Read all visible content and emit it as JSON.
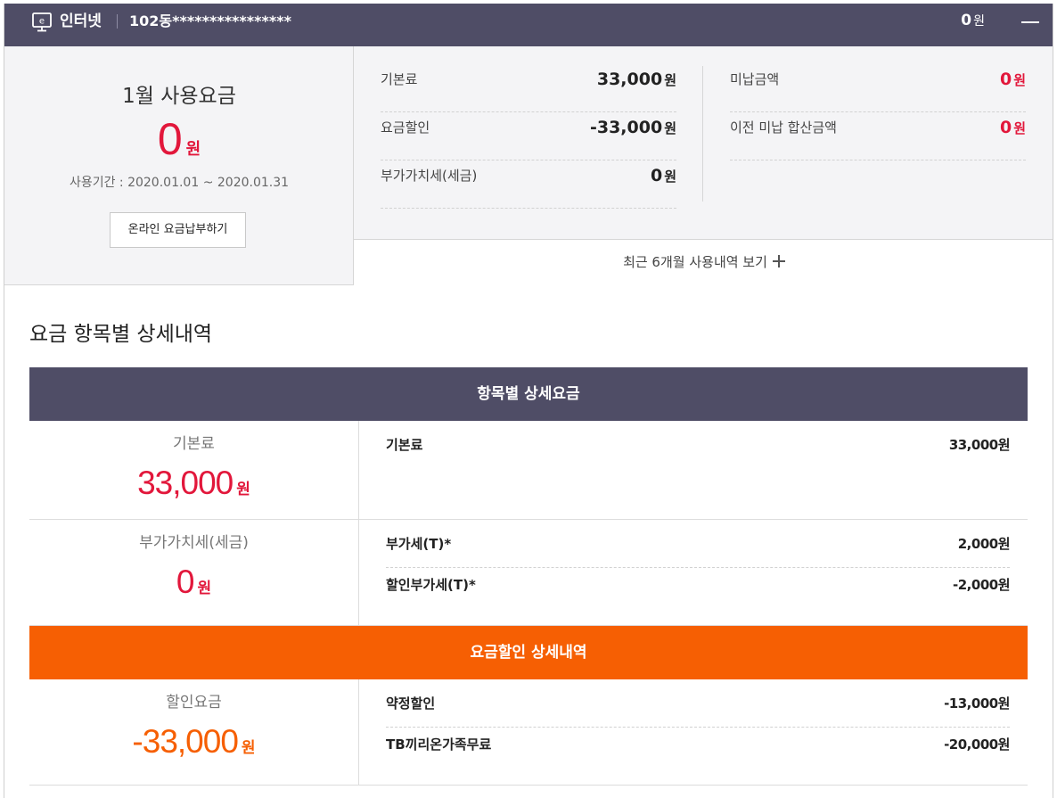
{
  "header": {
    "service": "인터넷",
    "address": "102동****************",
    "amount": "0",
    "amount_unit": "원",
    "icon_letter": "e"
  },
  "summary": {
    "month_title": "1월 사용요금",
    "total": "0",
    "total_unit": "원",
    "period": "사용기간 : 2020.01.01 ~ 2020.01.31",
    "pay_button": "온라인 요금납부하기",
    "left_items": [
      {
        "label": "기본료",
        "value": "33,000",
        "unit": "원"
      },
      {
        "label": "요금할인",
        "value": "-33,000",
        "unit": "원"
      },
      {
        "label": "부가가치세(세금)",
        "value": "0",
        "unit": "원"
      }
    ],
    "right_items": [
      {
        "label": "미납금액",
        "value": "0",
        "unit": "원"
      },
      {
        "label": "이전 미납 합산금액",
        "value": "0",
        "unit": "원"
      }
    ],
    "recent_link": "최근 6개월 사용내역 보기"
  },
  "detail": {
    "section_title": "요금 항목별 상세내역",
    "band_items": "항목별 상세요금",
    "band_discount": "요금할인 상세내역",
    "blocks": [
      {
        "caption": "기본료",
        "amount": "33,000",
        "unit": "원",
        "rows": [
          {
            "label": "기본료",
            "value": "33,000원"
          }
        ]
      },
      {
        "caption": "부가가치세(세금)",
        "amount": "0",
        "unit": "원",
        "rows": [
          {
            "label": "부가세(T)*",
            "value": "2,000원"
          },
          {
            "label": "할인부가세(T)*",
            "value": "-2,000원"
          }
        ]
      },
      {
        "caption": "할인요금",
        "amount": "-33,000",
        "unit": "원",
        "rows": [
          {
            "label": "약정할인",
            "value": "-13,000원"
          },
          {
            "label": "TB끼리온가족무료",
            "value": "-20,000원"
          }
        ]
      }
    ]
  },
  "colors": {
    "header_bg": "#4f4d66",
    "accent_red": "#e2173b",
    "accent_orange": "#f65f03"
  }
}
